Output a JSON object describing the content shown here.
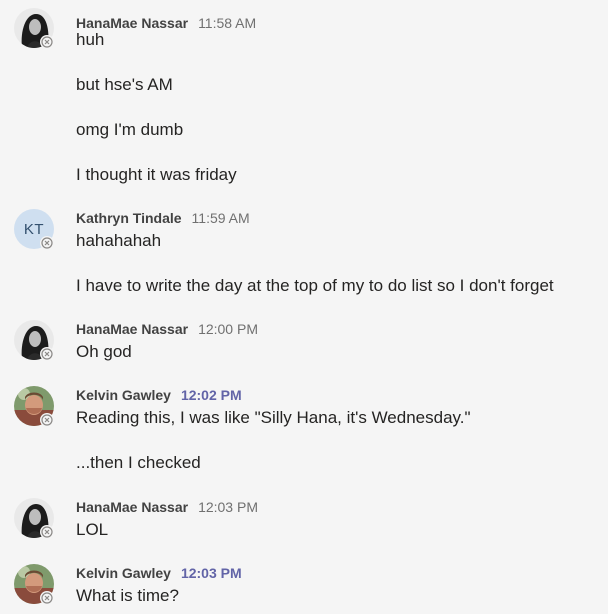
{
  "messages": [
    {
      "sender": "HanaMae Nassar",
      "time": "11:58 AM",
      "avatar": "photo-hanamae",
      "lines": [
        "huh",
        "but hse's AM",
        "omg I'm dumb",
        "I thought it was friday"
      ]
    },
    {
      "sender": "Kathryn Tindale",
      "time": "11:59 AM",
      "avatar_initials": "KT",
      "lines": [
        "hahahahah",
        "I have to write the day at the top of my to do list so I don't forget"
      ]
    },
    {
      "sender": "HanaMae Nassar",
      "time": "12:00 PM",
      "avatar": "photo-hanamae",
      "lines": [
        "Oh god"
      ]
    },
    {
      "sender": "Kelvin Gawley",
      "time": "12:02 PM",
      "avatar": "photo-kelvin",
      "lines": [
        "Reading this, I was like \"Silly Hana, it's Wednesday.\"",
        "...then I checked"
      ]
    },
    {
      "sender": "HanaMae Nassar",
      "time": "12:03 PM",
      "avatar": "photo-hanamae",
      "lines": [
        "LOL"
      ]
    },
    {
      "sender": "Kelvin Gawley",
      "time": "12:03 PM",
      "avatar": "photo-kelvin",
      "lines": [
        "What is time?"
      ]
    }
  ],
  "colors": {
    "background": "#f5f5f5",
    "accent_time": "#6264a7",
    "kt_avatar_bg": "#cfdff0"
  },
  "icons": {
    "presence": "presence-offline-icon"
  }
}
